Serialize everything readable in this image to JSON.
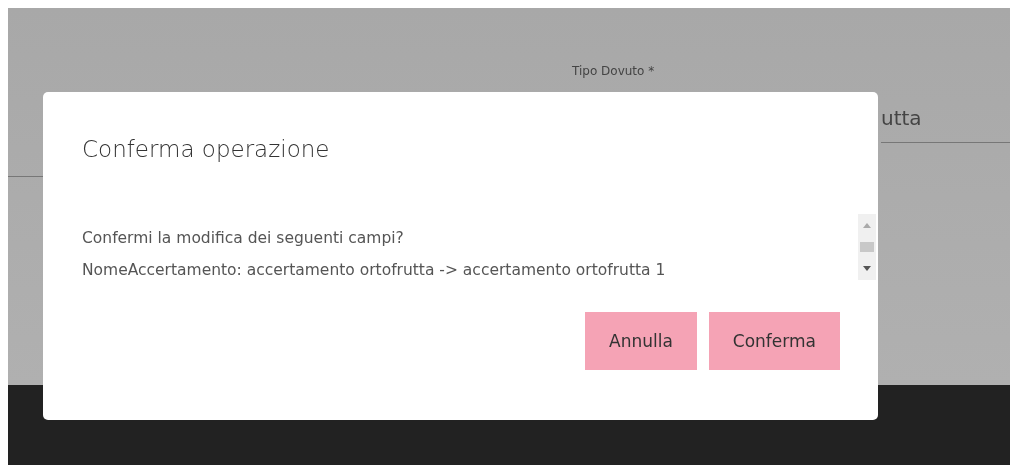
{
  "background_form": {
    "field_label": "Tipo Dovuto *",
    "field_value": "utta"
  },
  "dialog": {
    "title": "Conferma operazione",
    "message_lines": [
      "Confermi la modifica dei seguenti campi?",
      "NomeAccertamento: accertamento ortofrutta -> accertamento ortofrutta 1"
    ],
    "buttons": [
      "Annulla",
      "Conferma"
    ]
  }
}
